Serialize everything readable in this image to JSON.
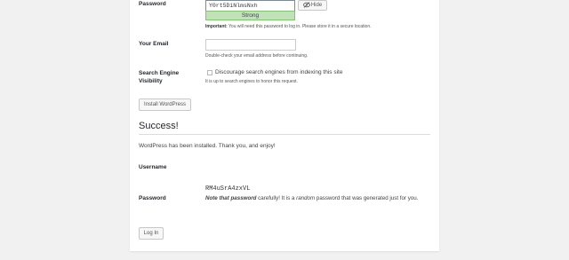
{
  "install_form": {
    "password_label": "Password",
    "password_value": "Y0rt5DiNlmsNxh",
    "strength_label": "Strong",
    "hide_button_label": "Hide",
    "password_hint_bold": "Important:",
    "password_hint": "You will need this password to log in. Please store it in a secure location.",
    "email_label": "Your Email",
    "email_value": "",
    "email_hint": "Double-check your email address before continuing.",
    "visibility_label_line1": "Search Engine",
    "visibility_label_line2": "Visibility",
    "visibility_checkbox_label": "Discourage search engines from indexing this site",
    "visibility_checked": false,
    "visibility_hint": "It is up to search engines to honor this request.",
    "install_button_label": "Install WordPress"
  },
  "success": {
    "title": "Success!",
    "message": "WordPress has been installed. Thank you, and enjoy!",
    "username_label": "Username",
    "username_value": "RM4uSrA4zxVL",
    "password_label": "Password",
    "note_bold_italic": "Note that password",
    "note_part1": "carefully! It is a",
    "note_italic": "random",
    "note_part2": "password that was generated just for you.",
    "login_button_label": "Log In"
  }
}
